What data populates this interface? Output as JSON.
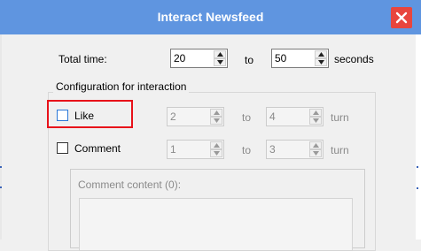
{
  "window": {
    "title": "Interact Newsfeed",
    "close_icon": "close-icon"
  },
  "total_time": {
    "label": "Total time:",
    "from": "20",
    "to_label": "to",
    "to": "50",
    "unit": "seconds"
  },
  "config": {
    "title": "Configuration for interaction",
    "like": {
      "label": "Like",
      "checked": false,
      "from": "2",
      "to_label": "to",
      "to": "4",
      "unit": "turn"
    },
    "comment": {
      "label": "Comment",
      "checked": false,
      "from": "1",
      "to_label": "to",
      "to": "3",
      "unit": "turn"
    },
    "comment_content_label": "Comment content (0):"
  },
  "colors": {
    "titlebar": "#5f95e0",
    "close": "#e8463e",
    "highlight": "#e8121a"
  }
}
